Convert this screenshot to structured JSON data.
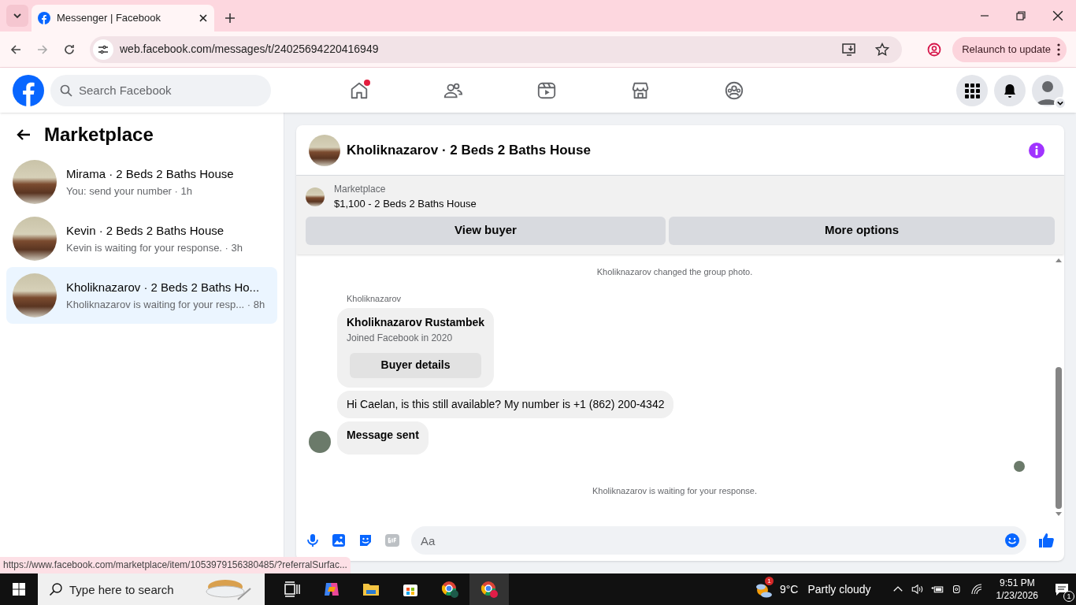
{
  "browser": {
    "tab_title": "Messenger | Facebook",
    "url": "web.facebook.com/messages/t/24025694220416949",
    "relaunch_label": "Relaunch to update",
    "status_url": "https://www.facebook.com/marketplace/item/1053979156380485/?referralSurfac..."
  },
  "header": {
    "search_placeholder": "Search Facebook",
    "nav": [
      {
        "kind": "home",
        "badge": true
      },
      {
        "kind": "friends",
        "badge": false
      },
      {
        "kind": "video",
        "badge": false
      },
      {
        "kind": "marketplace",
        "badge": false
      },
      {
        "kind": "groups",
        "badge": false
      }
    ]
  },
  "sidebar": {
    "title": "Marketplace",
    "conversations": [
      {
        "name": "Mirama · 2 Beds 2 Baths House",
        "preview": "You: send your number · 1h",
        "selected": false
      },
      {
        "name": "Kevin · 2 Beds 2 Baths House",
        "preview": "Kevin is waiting for your response. · 3h",
        "selected": false
      },
      {
        "name": "Kholiknazarov · 2 Beds 2 Baths Ho...",
        "preview": "Kholiknazarov is waiting for your resp... · 8h",
        "selected": true
      }
    ]
  },
  "chat": {
    "title": "Kholiknazarov · 2 Beds 2 Baths House",
    "listing": {
      "source": "Marketplace",
      "title": "$1,100 - 2 Beds 2 Baths House"
    },
    "buttons": [
      "View buyer",
      "More options"
    ],
    "messages": [
      {
        "kind": "system",
        "text": "Kholiknazarov changed the group photo."
      },
      {
        "kind": "sender",
        "text": "Kholiknazarov"
      },
      {
        "kind": "card",
        "text": "Kholiknazarov Rustambek",
        "subtitle": "Joined Facebook in 2020",
        "button": "Buyer details"
      },
      {
        "kind": "bubble",
        "text": "Hi Caelan, is this still available? My number is +1 (862) 200-4342",
        "bold": false,
        "avatar": false
      },
      {
        "kind": "bubble",
        "text": "Message sent",
        "bold": true,
        "avatar": true
      },
      {
        "kind": "seen"
      },
      {
        "kind": "system",
        "text": "Kholiknazarov is waiting for your response."
      }
    ],
    "composer_placeholder": "Aa"
  },
  "taskbar": {
    "search_placeholder": "Type here to search",
    "weather_badge": "1",
    "temperature": "9°C",
    "condition": "Partly cloudy",
    "time": "9:51 PM",
    "date": "1/23/2026",
    "notifications": "1"
  }
}
